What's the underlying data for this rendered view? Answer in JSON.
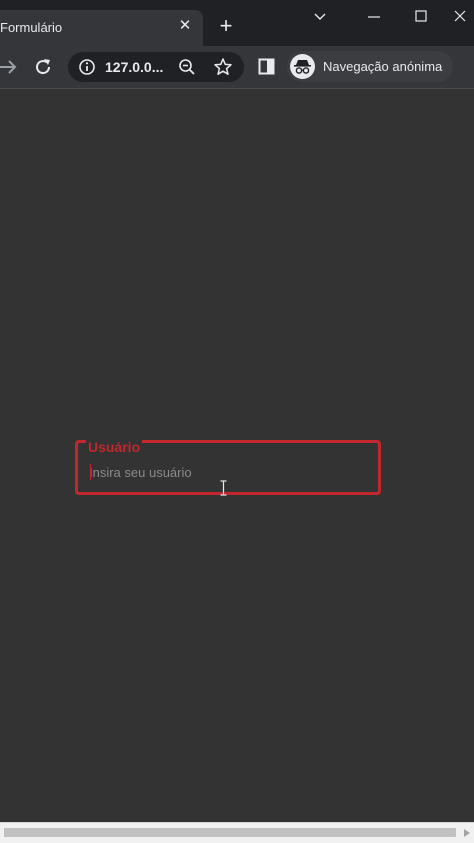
{
  "browser": {
    "tab_title": "Formulário",
    "url": "127.0.0...",
    "incognito_label": "Navegação anónima",
    "icons": {
      "close": "close-icon",
      "new_tab": "plus-icon",
      "tab_search": "chevron-down-icon",
      "minimize": "minimize-icon",
      "maximize": "maximize-icon",
      "window_close": "close-icon",
      "forward": "forward-arrow-icon",
      "reload": "reload-icon",
      "info": "info-icon",
      "zoom": "zoom-out-icon",
      "bookmark": "star-icon",
      "side_panel": "side-panel-icon",
      "incognito": "incognito-icon"
    }
  },
  "form": {
    "legend": "Usuário",
    "input": {
      "value": "",
      "placeholder": "Insira seu usuário"
    }
  },
  "colors": {
    "accent": "#c1272d",
    "page_bg": "#333333",
    "chrome_dark": "#202124",
    "toolbar": "#35363a"
  }
}
